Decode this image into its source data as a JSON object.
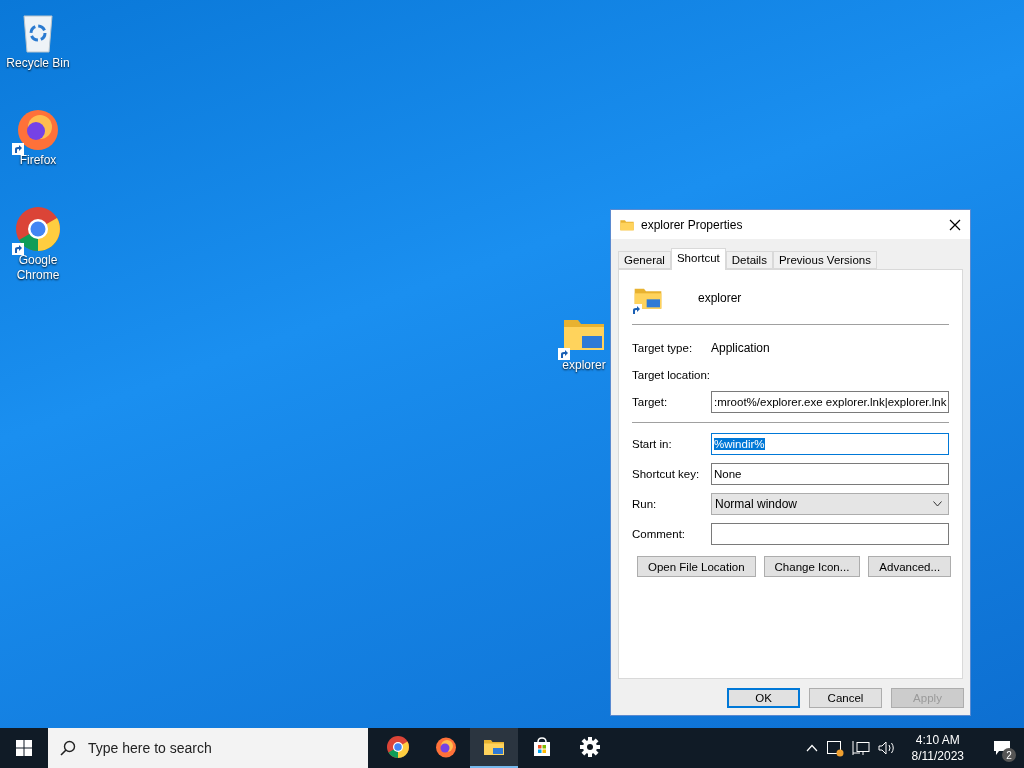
{
  "desktop_icons": [
    {
      "label": "Recycle Bin",
      "kind": "recycle",
      "shortcut": false
    },
    {
      "label": "Firefox",
      "kind": "firefox",
      "shortcut": true
    },
    {
      "label": "Google Chrome",
      "kind": "chrome",
      "shortcut": true
    },
    {
      "label": "explorer",
      "kind": "folder",
      "shortcut": true
    }
  ],
  "dialog": {
    "title": "explorer Properties",
    "tabs": [
      {
        "label": "General",
        "selected": false
      },
      {
        "label": "Shortcut",
        "selected": true
      },
      {
        "label": "Details",
        "selected": false
      },
      {
        "label": "Previous Versions",
        "selected": false
      }
    ],
    "name": "explorer",
    "info_rows": [
      {
        "label": "Target type:",
        "value": "Application"
      },
      {
        "label": "Target location:"
      }
    ],
    "target": {
      "label": "Target:",
      "value": ":mroot%/explorer.exe explorer.lnk|explorer.lnk"
    },
    "form_rows": [
      {
        "label": "Start in:",
        "value": "%windir%",
        "kind": "input",
        "text_selected": true
      },
      {
        "label": "Shortcut key:",
        "value": "None",
        "kind": "input",
        "text_selected": false
      },
      {
        "label": "Run:",
        "value": "Normal window",
        "kind": "select"
      },
      {
        "label": "Comment:",
        "kind": "input",
        "text_selected": false
      }
    ],
    "actions": [
      "Open File Location",
      "Change Icon...",
      "Advanced..."
    ],
    "footer_buttons": [
      {
        "label": "OK",
        "default": true,
        "disabled": false
      },
      {
        "label": "Cancel",
        "default": false,
        "disabled": false
      },
      {
        "label": "Apply",
        "default": false,
        "disabled": true
      }
    ]
  },
  "taskbar": {
    "search": {
      "placeholder": "Type here to search"
    },
    "apps": [
      {
        "kind": "chrome",
        "active": false
      },
      {
        "kind": "firefox",
        "active": false
      },
      {
        "kind": "folder",
        "active": true
      },
      {
        "kind": "store",
        "active": false
      },
      {
        "kind": "settings",
        "active": false
      }
    ],
    "time": "4:10 AM",
    "date": "8/11/2023",
    "notifications": "2"
  }
}
